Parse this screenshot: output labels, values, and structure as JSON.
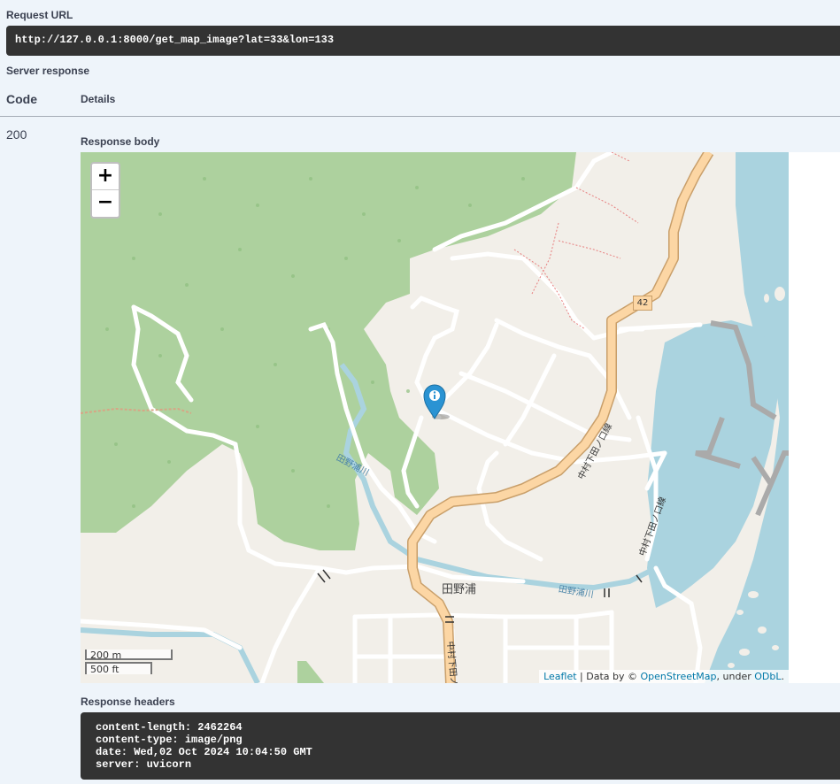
{
  "request_url": {
    "label": "Request URL",
    "value": "http://127.0.0.1:8000/get_map_image?lat=33&lon=133"
  },
  "server_response": {
    "label": "Server response",
    "code_header": "Code",
    "details_header": "Details"
  },
  "response": {
    "code": "200",
    "body_label": "Response body",
    "headers_label": "Response headers",
    "headers": [
      "content-length: 2462264",
      "content-type: image/png",
      "date: Wed,02 Oct 2024 10:04:50 GMT",
      "server: uvicorn"
    ]
  },
  "map": {
    "zoom_in": "+",
    "zoom_out": "−",
    "scale_metric": "200 m",
    "scale_imperial": "500 ft",
    "marker_icon": "info-marker-icon",
    "labels": {
      "place": "田野浦",
      "river_left": "田野浦川",
      "river_right": "田野浦川",
      "road_main": "中村下田ノ口線",
      "road_side": "中村下田ノ口線",
      "road_bottom": "中村下田ノ",
      "route_number": "42"
    },
    "attribution": {
      "leaflet": "Leaflet",
      "sep1": " | Data by © ",
      "osm": "OpenStreetMap",
      "sep2": ", under ",
      "odbl": "ODbL",
      "end": "."
    },
    "colors": {
      "forest": "#add19e",
      "land": "#f2efe9",
      "water": "#aad3df",
      "primary_road": "#fcd6a4",
      "marker": "#2a93d3"
    }
  }
}
